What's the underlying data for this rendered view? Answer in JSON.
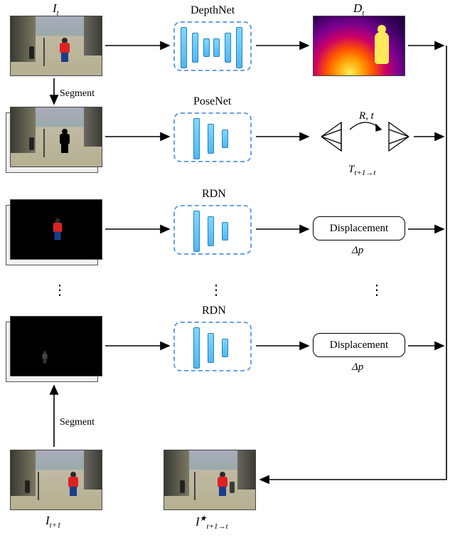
{
  "labels": {
    "I_t": "I",
    "I_t_sub": "t",
    "D_t": "D",
    "D_t_sub": "t",
    "segment_top": "Segment",
    "segment_bottom": "Segment",
    "depthnet": "DepthNet",
    "posenet": "PoseNet",
    "rdn1": "RDN",
    "rdn2": "RDN",
    "Rt": "R, t",
    "T_sub": "t+1→t",
    "T": "T",
    "disp1": "Displacement",
    "disp2": "Displacement",
    "dp1": "Δp",
    "dp2": "Δp",
    "I_tp1": "I",
    "I_tp1_sub": "t+1",
    "I_star": "I",
    "I_star_sup": "★",
    "I_star_sub": "t+1→t",
    "dots": "⋮"
  },
  "chart_data": {
    "type": "diagram",
    "nodes": [
      {
        "id": "I_t",
        "kind": "image",
        "label": "I_t",
        "desc": "input frame t (street scene, person in red jacket)"
      },
      {
        "id": "I_t_seg",
        "kind": "image",
        "label": "segmented I_t",
        "desc": "I_t with pedestrian masked black"
      },
      {
        "id": "obj1",
        "kind": "image",
        "label": "object crop 1",
        "desc": "masked pedestrian (red jacket) on black"
      },
      {
        "id": "objN",
        "kind": "image",
        "label": "object crop N",
        "desc": "faint small pedestrian on black"
      },
      {
        "id": "I_tp1",
        "kind": "image",
        "label": "I_{t+1}",
        "desc": "input frame t+1 (street scene shifted)"
      },
      {
        "id": "I_tp1_seg",
        "kind": "image",
        "label": "segmented I_{t+1}",
        "desc": "stacked behind object crops"
      },
      {
        "id": "DepthNet",
        "kind": "network",
        "shape": "encoder-decoder"
      },
      {
        "id": "PoseNet",
        "kind": "network",
        "shape": "encoder"
      },
      {
        "id": "RDN1",
        "kind": "network",
        "label": "RDN",
        "shape": "encoder"
      },
      {
        "id": "RDN2",
        "kind": "network",
        "label": "RDN",
        "shape": "encoder"
      },
      {
        "id": "D_t",
        "kind": "image",
        "label": "D_t",
        "desc": "predicted depth map"
      },
      {
        "id": "Pose",
        "kind": "output",
        "label": "T_{t+1→t}",
        "desc": "camera pose R,t between two frusta"
      },
      {
        "id": "Disp1",
        "kind": "output",
        "label": "Δp",
        "desc": "Displacement for object 1"
      },
      {
        "id": "DispN",
        "kind": "output",
        "label": "Δp",
        "desc": "Displacement for object N"
      },
      {
        "id": "I_star",
        "kind": "image",
        "label": "I★_{t+1→t}",
        "desc": "warped/reconstructed frame"
      }
    ],
    "edges": [
      {
        "from": "I_t",
        "to": "DepthNet"
      },
      {
        "from": "DepthNet",
        "to": "D_t"
      },
      {
        "from": "I_t",
        "to": "I_t_seg",
        "label": "Segment"
      },
      {
        "from": "I_t_seg",
        "to": "PoseNet"
      },
      {
        "from": "PoseNet",
        "to": "Pose"
      },
      {
        "from": "obj1",
        "to": "RDN1"
      },
      {
        "from": "RDN1",
        "to": "Disp1"
      },
      {
        "from": "objN",
        "to": "RDN2"
      },
      {
        "from": "RDN2",
        "to": "DispN"
      },
      {
        "from": "I_tp1",
        "to": "I_tp1_seg",
        "label": "Segment"
      },
      {
        "from": "D_t",
        "to": "I_star",
        "via": "right-bus"
      },
      {
        "from": "Pose",
        "to": "I_star",
        "via": "right-bus"
      },
      {
        "from": "Disp1",
        "to": "I_star",
        "via": "right-bus"
      },
      {
        "from": "DispN",
        "to": "I_star",
        "via": "right-bus"
      }
    ]
  }
}
